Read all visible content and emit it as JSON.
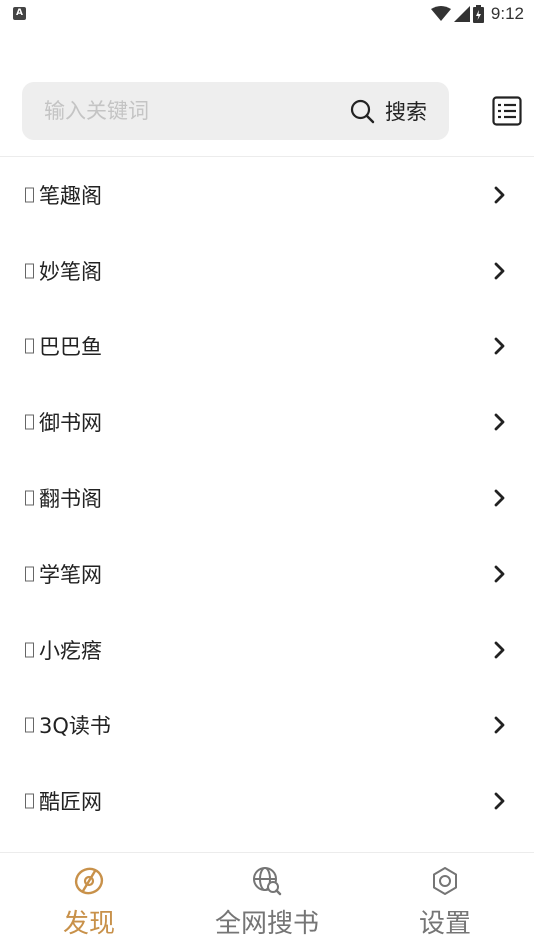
{
  "status_bar": {
    "notification_icon": "A",
    "time": "9:12",
    "icons": [
      "wifi-icon",
      "signal-icon",
      "battery-icon"
    ]
  },
  "search": {
    "placeholder": "输入关键词",
    "value": "",
    "button_label": "搜索",
    "search_icon": "search-icon",
    "list_icon": "list-icon"
  },
  "sources": [
    {
      "label": "笔趣阁"
    },
    {
      "label": "妙笔阁"
    },
    {
      "label": "巴巴鱼"
    },
    {
      "label": "御书网"
    },
    {
      "label": "翻书阁"
    },
    {
      "label": "学笔网"
    },
    {
      "label": "小疙瘩"
    },
    {
      "label": "3Q读书"
    },
    {
      "label": "酷匠网"
    }
  ],
  "bottom_nav": {
    "items": [
      {
        "label": "发现",
        "icon": "compass-icon",
        "active": true
      },
      {
        "label": "全网搜书",
        "icon": "globe-search-icon",
        "active": false
      },
      {
        "label": "设置",
        "icon": "gear-icon",
        "active": false
      }
    ]
  },
  "colors": {
    "accent": "#c8914a",
    "inactive": "#757575",
    "search_bg": "#eeeeee"
  }
}
